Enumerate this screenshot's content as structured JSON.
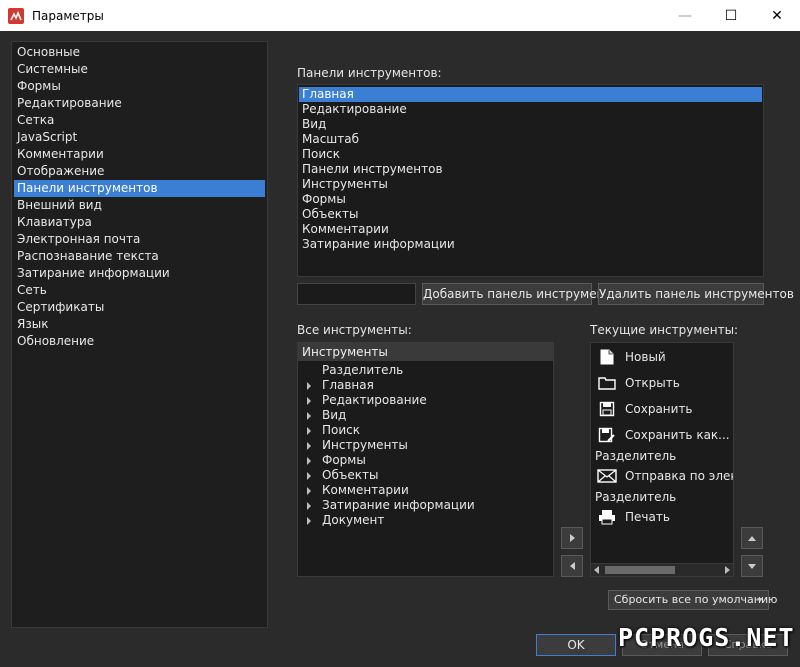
{
  "window": {
    "title": "Параметры",
    "controls": {
      "minimize": "—",
      "maximize": "☐",
      "close": "✕"
    }
  },
  "categories": [
    {
      "label": "Основные"
    },
    {
      "label": "Системные"
    },
    {
      "label": "Формы"
    },
    {
      "label": "Редактирование"
    },
    {
      "label": "Сетка"
    },
    {
      "label": "JavaScript"
    },
    {
      "label": "Комментарии"
    },
    {
      "label": "Отображение"
    },
    {
      "label": "Панели инструментов",
      "selected": true
    },
    {
      "label": "Внешний вид"
    },
    {
      "label": "Клавиатура"
    },
    {
      "label": "Электронная почта"
    },
    {
      "label": "Распознавание текста"
    },
    {
      "label": "Затирание информации"
    },
    {
      "label": "Сеть"
    },
    {
      "label": "Сертификаты"
    },
    {
      "label": "Язык"
    },
    {
      "label": "Обновление"
    }
  ],
  "toolbars": {
    "label": "Панели инструментов:",
    "items": [
      {
        "label": "Главная",
        "selected": true
      },
      {
        "label": "Редактирование"
      },
      {
        "label": "Вид"
      },
      {
        "label": "Масштаб"
      },
      {
        "label": "Поиск"
      },
      {
        "label": "Панели инструментов"
      },
      {
        "label": "Инструменты"
      },
      {
        "label": "Формы"
      },
      {
        "label": "Объекты"
      },
      {
        "label": "Комментарии"
      },
      {
        "label": "Затирание информации"
      }
    ],
    "name_value": "",
    "add_button": "Добавить панель инструментов",
    "remove_button": "Удалить панель инструментов"
  },
  "all_tools": {
    "label": "Все инструменты:",
    "header": "Инструменты",
    "items": [
      {
        "label": "Разделитель",
        "expandable": false
      },
      {
        "label": "Главная",
        "expandable": true
      },
      {
        "label": "Редактирование",
        "expandable": true
      },
      {
        "label": "Вид",
        "expandable": true
      },
      {
        "label": "Поиск",
        "expandable": true
      },
      {
        "label": "Инструменты",
        "expandable": true
      },
      {
        "label": "Формы",
        "expandable": true
      },
      {
        "label": "Объекты",
        "expandable": true
      },
      {
        "label": "Комментарии",
        "expandable": true
      },
      {
        "label": "Затирание информации",
        "expandable": true
      },
      {
        "label": "Документ",
        "expandable": true
      }
    ]
  },
  "current_tools": {
    "label": "Текущие инструменты:",
    "items": [
      {
        "label": "Новый",
        "icon": "new-document-icon"
      },
      {
        "label": "Открыть",
        "icon": "open-folder-icon"
      },
      {
        "label": "Сохранить",
        "icon": "save-icon"
      },
      {
        "label": "Сохранить как...",
        "icon": "save-as-icon"
      },
      {
        "label": "Разделитель",
        "separator": true
      },
      {
        "label": "Отправка по электронной почте",
        "icon": "email-icon"
      },
      {
        "label": "Разделитель",
        "separator": true
      },
      {
        "label": "Печать",
        "icon": "print-icon"
      }
    ]
  },
  "reset_button": "Сбросить все по умолчанию",
  "footer": {
    "ok": "OK",
    "cancel": "Отмена",
    "help": "Справка"
  },
  "watermark": "PCPROGS.NET",
  "colors": {
    "accent": "#3a7fd4",
    "background": "#2b2b2b",
    "list_background": "#1b1b1b",
    "app_icon": "#d23a2f"
  }
}
